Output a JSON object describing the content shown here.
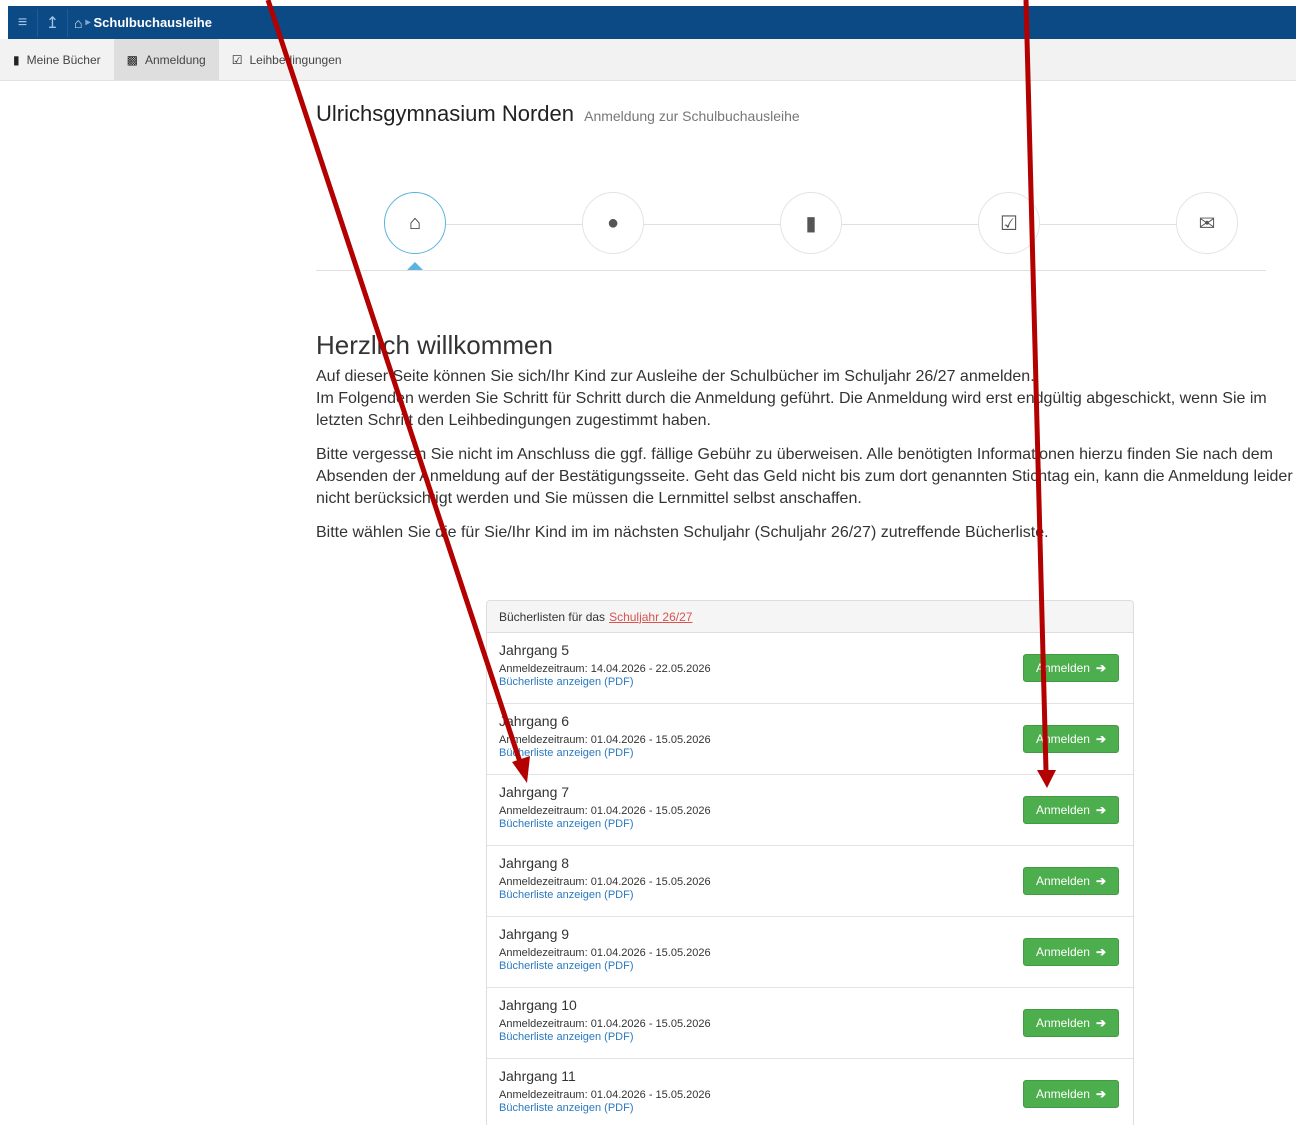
{
  "topbar": {
    "menu_icon": "hamburger-icon",
    "up_icon": "arrow-up-icon",
    "home_icon": "home-icon",
    "breadcrumb": "Schulbuchausleihe"
  },
  "tabs": [
    {
      "label": "Meine Bücher",
      "icon": "book-icon"
    },
    {
      "label": "Anmeldung",
      "icon": "document-icon"
    },
    {
      "label": "Leihbedingungen",
      "icon": "checkbox-icon"
    }
  ],
  "header": {
    "school": "Ulrichsgymnasium Norden",
    "subtitle": "Anmeldung zur Schulbuchausleihe"
  },
  "wizard": {
    "steps": [
      "home-icon",
      "user-icon",
      "book-icon",
      "checkbox-icon",
      "envelope-icon"
    ],
    "active_step": 0
  },
  "welcome": {
    "title": "Herzlich willkommen",
    "p1_line1": "Auf dieser Seite können Sie sich/Ihr Kind zur Ausleihe der Schulbücher im Schuljahr 26/27 anmelden.",
    "p1_line2": "Im Folgenden werden Sie Schritt für Schritt durch die Anmeldung geführt. Die Anmeldung wird erst endgültig abgeschickt, wenn Sie im letzten Schritt den Leihbedingungen zugestimmt haben.",
    "p2": "Bitte vergessen Sie nicht im Anschluss die ggf. fällige Gebühr zu überweisen. Alle benötigten Informationen hierzu finden Sie nach dem Absenden der Anmeldung auf der Bestätigungsseite. Geht das Geld nicht bis zum dort genannten Stichtag ein, kann die Anmeldung leider nicht berücksichtigt werden und Sie müssen die Lernmittel selbst anschaffen.",
    "p3": "Bitte wählen Sie die für Sie/Ihr Kind im im nächsten Schuljahr (Schuljahr 26/27) zutreffende Bücherliste."
  },
  "panel": {
    "heading": "Bücherlisten für das",
    "heading_link": "Schuljahr 26/27",
    "rows": [
      {
        "title": "Jahrgang 5",
        "period": "Anmeldezeitraum: 14.04.2026 - 22.05.2026",
        "link": "Bücherliste anzeigen (PDF)",
        "button": "Anmelden"
      },
      {
        "title": "Jahrgang 6",
        "period": "Anmeldezeitraum: 01.04.2026 - 15.05.2026",
        "link": "Bücherliste anzeigen (PDF)",
        "button": "Anmelden"
      },
      {
        "title": "Jahrgang 7",
        "period": "Anmeldezeitraum: 01.04.2026 - 15.05.2026",
        "link": "Bücherliste anzeigen (PDF)",
        "button": "Anmelden"
      },
      {
        "title": "Jahrgang 8",
        "period": "Anmeldezeitraum: 01.04.2026 - 15.05.2026",
        "link": "Bücherliste anzeigen (PDF)",
        "button": "Anmelden"
      },
      {
        "title": "Jahrgang 9",
        "period": "Anmeldezeitraum: 01.04.2026 - 15.05.2026",
        "link": "Bücherliste anzeigen (PDF)",
        "button": "Anmelden"
      },
      {
        "title": "Jahrgang 10",
        "period": "Anmeldezeitraum: 01.04.2026 - 15.05.2026",
        "link": "Bücherliste anzeigen (PDF)",
        "button": "Anmelden"
      },
      {
        "title": "Jahrgang 11",
        "period": "Anmeldezeitraum: 01.04.2026 - 15.05.2026",
        "link": "Bücherliste anzeigen (PDF)",
        "button": "Anmelden"
      }
    ]
  },
  "colors": {
    "topbar": "#0c4a85",
    "button_green": "#4cae4c",
    "link_blue": "#2a79c0",
    "link_red": "#d9534f",
    "arrow_red": "#b30000",
    "wizard_active": "#5bb3e0"
  }
}
